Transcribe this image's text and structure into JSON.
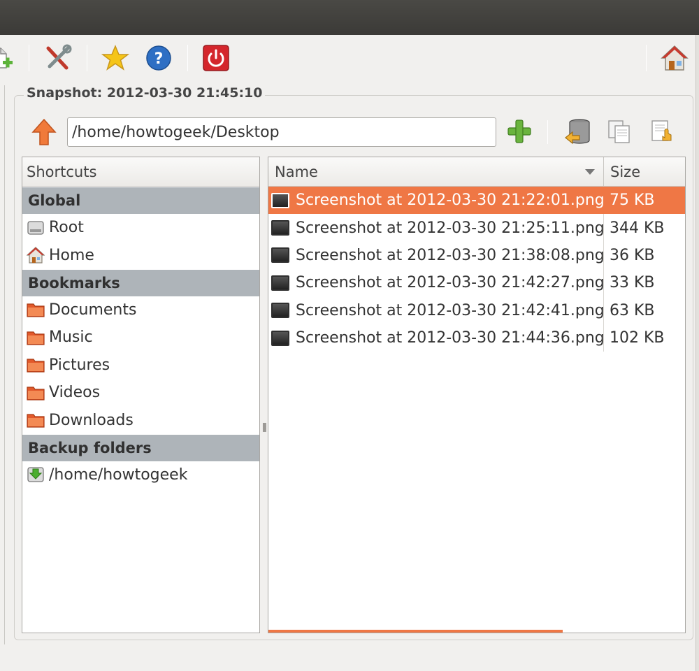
{
  "toolbar": {
    "buttons": [
      "add-file-icon",
      "settings-icon",
      "bookmark-star-icon",
      "help-icon",
      "shutdown-icon",
      "home-icon"
    ]
  },
  "snapshot": {
    "title": "Snapshot: 2012-03-30 21:45:10",
    "path": "/home/howtogeek/Desktop"
  },
  "shortcuts": {
    "header": "Shortcuts",
    "groups": [
      {
        "label": "Global",
        "items": [
          "Root",
          "Home"
        ]
      },
      {
        "label": "Bookmarks",
        "items": [
          "Documents",
          "Music",
          "Pictures",
          "Videos",
          "Downloads"
        ]
      },
      {
        "label": "Backup folders",
        "items": [
          "/home/howtogeek"
        ]
      }
    ]
  },
  "files": {
    "columns": {
      "name": "Name",
      "size": "Size"
    },
    "rows": [
      {
        "name": "Screenshot at 2012-03-30 21:22:01.png",
        "size": "75 KB",
        "selected": true
      },
      {
        "name": "Screenshot at 2012-03-30 21:25:11.png",
        "size": "344 KB"
      },
      {
        "name": "Screenshot at 2012-03-30 21:38:08.png",
        "size": "36 KB"
      },
      {
        "name": "Screenshot at 2012-03-30 21:42:27.png",
        "size": "33 KB"
      },
      {
        "name": "Screenshot at 2012-03-30 21:42:41.png",
        "size": "63 KB"
      },
      {
        "name": "Screenshot at 2012-03-30 21:44:36.png",
        "size": "102 KB"
      }
    ]
  },
  "colors": {
    "selection": "#ef7745",
    "group_header": "#aeb4b9",
    "titlebar": "#3c3b37"
  }
}
